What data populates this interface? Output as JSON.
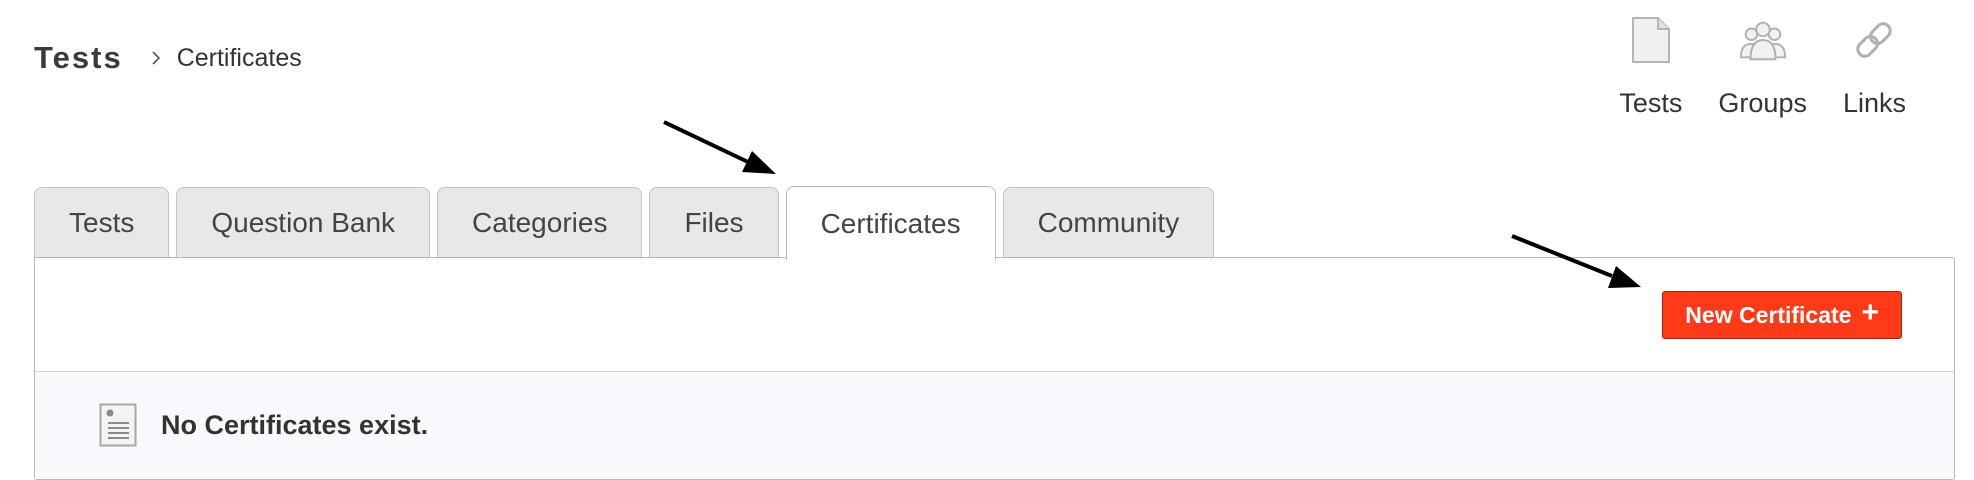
{
  "breadcrumb": {
    "root": "Tests",
    "current": "Certificates"
  },
  "quicknav": [
    {
      "label": "Tests",
      "icon": "document-icon"
    },
    {
      "label": "Groups",
      "icon": "users-icon"
    },
    {
      "label": "Links",
      "icon": "chain-link-icon"
    }
  ],
  "tabs": [
    {
      "label": "Tests",
      "active": false
    },
    {
      "label": "Question Bank",
      "active": false
    },
    {
      "label": "Categories",
      "active": false
    },
    {
      "label": "Files",
      "active": false
    },
    {
      "label": "Certificates",
      "active": true
    },
    {
      "label": "Community",
      "active": false
    }
  ],
  "toolbar": {
    "new_button_label": "New Certificate",
    "new_button_icon": "plus-icon"
  },
  "empty_state": {
    "message": "No Certificates exist.",
    "icon": "certificate-document-icon"
  },
  "colors": {
    "accent": "#ff3a18",
    "tab_inactive": "#e8e8e8",
    "empty_background": "#f8f9fd"
  }
}
